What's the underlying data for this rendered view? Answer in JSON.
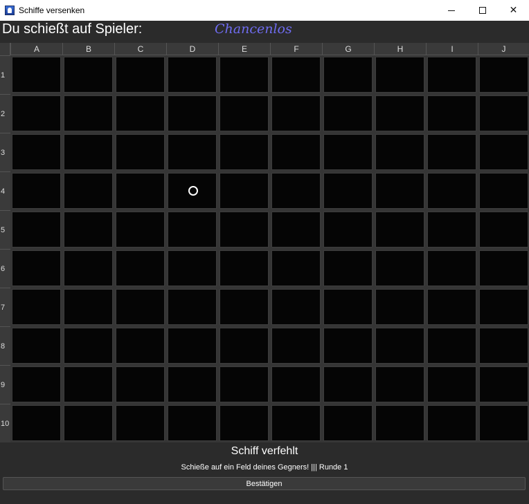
{
  "window": {
    "title": "Schiffe versenken",
    "icon": "app-icon"
  },
  "header": {
    "shoot_label": "Du schießt auf Spieler:",
    "player_name": "Chancenlos",
    "player_color": "#6f6cf0"
  },
  "board": {
    "columns": [
      "A",
      "B",
      "C",
      "D",
      "E",
      "F",
      "G",
      "H",
      "I",
      "J"
    ],
    "rows": [
      "1",
      "2",
      "3",
      "4",
      "5",
      "6",
      "7",
      "8",
      "9",
      "10"
    ],
    "cell_color": "#050505",
    "marked_cells": [
      {
        "col": "D",
        "row": "4",
        "mark": "circle",
        "meaning": "selected"
      }
    ]
  },
  "status": {
    "message": "Schiff verfehlt",
    "instruction": "Schieße auf ein Feld deines Gegners! ||| Runde 1"
  },
  "confirm_button": {
    "label": "Bestätigen"
  }
}
